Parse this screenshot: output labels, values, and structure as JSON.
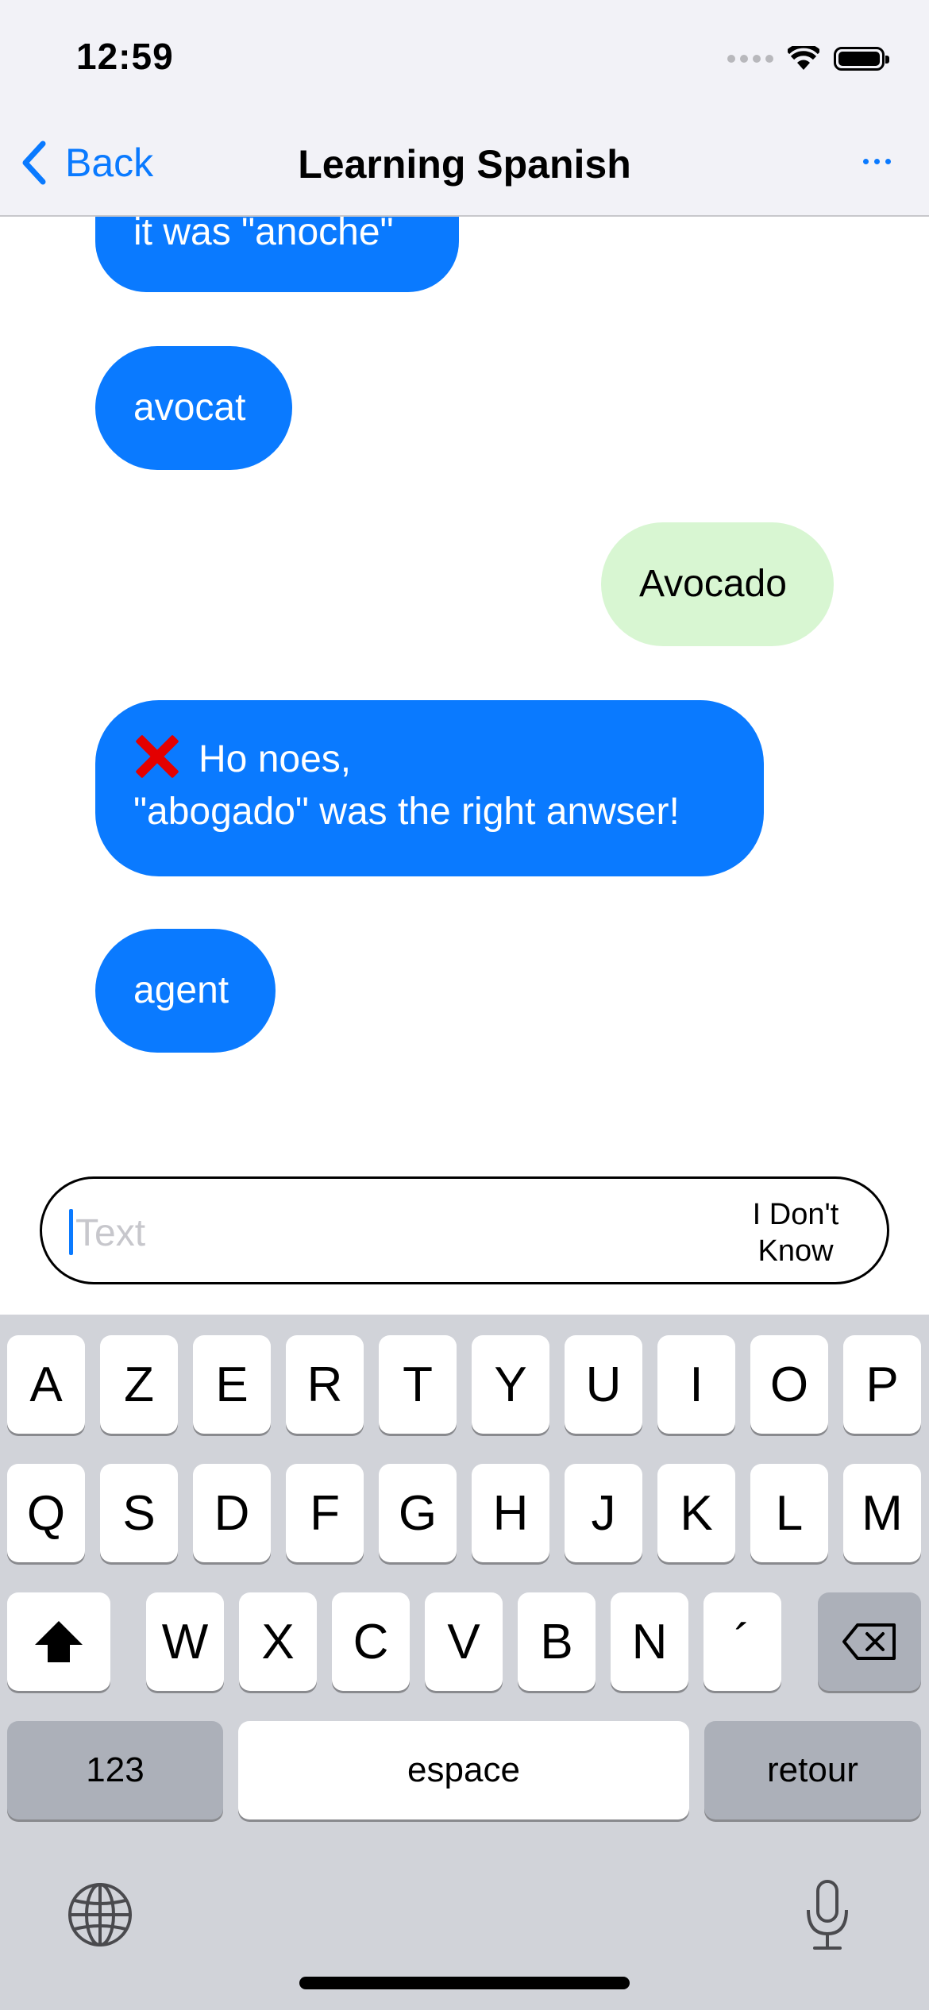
{
  "status_bar": {
    "time": "12:59"
  },
  "nav": {
    "back_label": "Back",
    "title": "Learning Spanish",
    "more_label": "..."
  },
  "messages": [
    {
      "from": "bot",
      "text": "it was \"anoche\""
    },
    {
      "from": "bot",
      "text": "avocat"
    },
    {
      "from": "user",
      "text": "Avocado"
    },
    {
      "from": "bot",
      "text_line1": "Ho noes,",
      "text_line2": "\"abogado\" was the right anwser!",
      "icon": "cross-mark-icon"
    },
    {
      "from": "bot",
      "text": "agent"
    }
  ],
  "input": {
    "placeholder": "Text",
    "value": "",
    "idk_line1": "I Don't",
    "idk_line2": "Know"
  },
  "keyboard": {
    "row1": [
      "A",
      "Z",
      "E",
      "R",
      "T",
      "Y",
      "U",
      "I",
      "O",
      "P"
    ],
    "row2": [
      "Q",
      "S",
      "D",
      "F",
      "G",
      "H",
      "J",
      "K",
      "L",
      "M"
    ],
    "row3": [
      "W",
      "X",
      "C",
      "V",
      "B",
      "N",
      "´"
    ],
    "numbers_label": "123",
    "space_label": "espace",
    "return_label": "retour"
  },
  "colors": {
    "accent": "#0a7aff",
    "user_bubble": "#d8f6d2",
    "error": "#e40000",
    "keyboard_bg": "#d1d3d9"
  }
}
